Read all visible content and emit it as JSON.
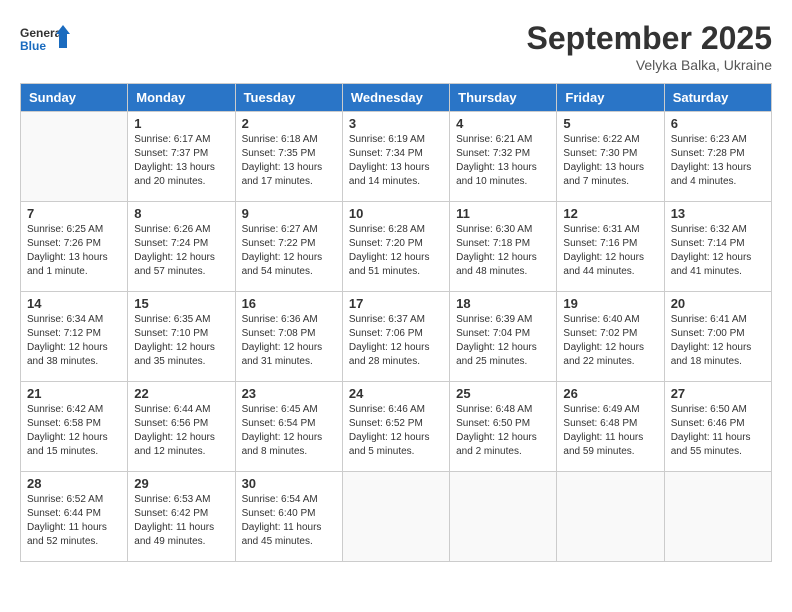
{
  "header": {
    "logo_line1": "General",
    "logo_line2": "Blue",
    "month": "September 2025",
    "location": "Velyka Balka, Ukraine"
  },
  "days_of_week": [
    "Sunday",
    "Monday",
    "Tuesday",
    "Wednesday",
    "Thursday",
    "Friday",
    "Saturday"
  ],
  "weeks": [
    [
      {
        "day": "",
        "info": ""
      },
      {
        "day": "1",
        "info": "Sunrise: 6:17 AM\nSunset: 7:37 PM\nDaylight: 13 hours\nand 20 minutes."
      },
      {
        "day": "2",
        "info": "Sunrise: 6:18 AM\nSunset: 7:35 PM\nDaylight: 13 hours\nand 17 minutes."
      },
      {
        "day": "3",
        "info": "Sunrise: 6:19 AM\nSunset: 7:34 PM\nDaylight: 13 hours\nand 14 minutes."
      },
      {
        "day": "4",
        "info": "Sunrise: 6:21 AM\nSunset: 7:32 PM\nDaylight: 13 hours\nand 10 minutes."
      },
      {
        "day": "5",
        "info": "Sunrise: 6:22 AM\nSunset: 7:30 PM\nDaylight: 13 hours\nand 7 minutes."
      },
      {
        "day": "6",
        "info": "Sunrise: 6:23 AM\nSunset: 7:28 PM\nDaylight: 13 hours\nand 4 minutes."
      }
    ],
    [
      {
        "day": "7",
        "info": "Sunrise: 6:25 AM\nSunset: 7:26 PM\nDaylight: 13 hours\nand 1 minute."
      },
      {
        "day": "8",
        "info": "Sunrise: 6:26 AM\nSunset: 7:24 PM\nDaylight: 12 hours\nand 57 minutes."
      },
      {
        "day": "9",
        "info": "Sunrise: 6:27 AM\nSunset: 7:22 PM\nDaylight: 12 hours\nand 54 minutes."
      },
      {
        "day": "10",
        "info": "Sunrise: 6:28 AM\nSunset: 7:20 PM\nDaylight: 12 hours\nand 51 minutes."
      },
      {
        "day": "11",
        "info": "Sunrise: 6:30 AM\nSunset: 7:18 PM\nDaylight: 12 hours\nand 48 minutes."
      },
      {
        "day": "12",
        "info": "Sunrise: 6:31 AM\nSunset: 7:16 PM\nDaylight: 12 hours\nand 44 minutes."
      },
      {
        "day": "13",
        "info": "Sunrise: 6:32 AM\nSunset: 7:14 PM\nDaylight: 12 hours\nand 41 minutes."
      }
    ],
    [
      {
        "day": "14",
        "info": "Sunrise: 6:34 AM\nSunset: 7:12 PM\nDaylight: 12 hours\nand 38 minutes."
      },
      {
        "day": "15",
        "info": "Sunrise: 6:35 AM\nSunset: 7:10 PM\nDaylight: 12 hours\nand 35 minutes."
      },
      {
        "day": "16",
        "info": "Sunrise: 6:36 AM\nSunset: 7:08 PM\nDaylight: 12 hours\nand 31 minutes."
      },
      {
        "day": "17",
        "info": "Sunrise: 6:37 AM\nSunset: 7:06 PM\nDaylight: 12 hours\nand 28 minutes."
      },
      {
        "day": "18",
        "info": "Sunrise: 6:39 AM\nSunset: 7:04 PM\nDaylight: 12 hours\nand 25 minutes."
      },
      {
        "day": "19",
        "info": "Sunrise: 6:40 AM\nSunset: 7:02 PM\nDaylight: 12 hours\nand 22 minutes."
      },
      {
        "day": "20",
        "info": "Sunrise: 6:41 AM\nSunset: 7:00 PM\nDaylight: 12 hours\nand 18 minutes."
      }
    ],
    [
      {
        "day": "21",
        "info": "Sunrise: 6:42 AM\nSunset: 6:58 PM\nDaylight: 12 hours\nand 15 minutes."
      },
      {
        "day": "22",
        "info": "Sunrise: 6:44 AM\nSunset: 6:56 PM\nDaylight: 12 hours\nand 12 minutes."
      },
      {
        "day": "23",
        "info": "Sunrise: 6:45 AM\nSunset: 6:54 PM\nDaylight: 12 hours\nand 8 minutes."
      },
      {
        "day": "24",
        "info": "Sunrise: 6:46 AM\nSunset: 6:52 PM\nDaylight: 12 hours\nand 5 minutes."
      },
      {
        "day": "25",
        "info": "Sunrise: 6:48 AM\nSunset: 6:50 PM\nDaylight: 12 hours\nand 2 minutes."
      },
      {
        "day": "26",
        "info": "Sunrise: 6:49 AM\nSunset: 6:48 PM\nDaylight: 11 hours\nand 59 minutes."
      },
      {
        "day": "27",
        "info": "Sunrise: 6:50 AM\nSunset: 6:46 PM\nDaylight: 11 hours\nand 55 minutes."
      }
    ],
    [
      {
        "day": "28",
        "info": "Sunrise: 6:52 AM\nSunset: 6:44 PM\nDaylight: 11 hours\nand 52 minutes."
      },
      {
        "day": "29",
        "info": "Sunrise: 6:53 AM\nSunset: 6:42 PM\nDaylight: 11 hours\nand 49 minutes."
      },
      {
        "day": "30",
        "info": "Sunrise: 6:54 AM\nSunset: 6:40 PM\nDaylight: 11 hours\nand 45 minutes."
      },
      {
        "day": "",
        "info": ""
      },
      {
        "day": "",
        "info": ""
      },
      {
        "day": "",
        "info": ""
      },
      {
        "day": "",
        "info": ""
      }
    ]
  ]
}
